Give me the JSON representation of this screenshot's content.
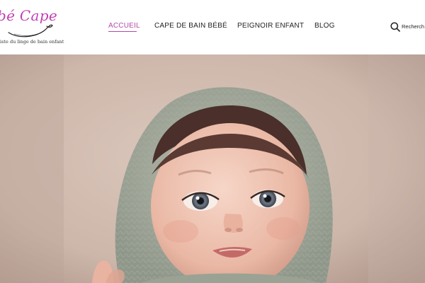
{
  "logo": {
    "script_text": "bé Cape",
    "tagline": "iste du linge de bain enfant"
  },
  "nav": {
    "items": [
      {
        "label": "ACCUEIL",
        "active": true
      },
      {
        "label": "CAPE DE BAIN BÉBÉ",
        "active": false
      },
      {
        "label": "PEIGNOIR ENFANT",
        "active": false
      },
      {
        "label": "BLOG",
        "active": false
      }
    ]
  },
  "search": {
    "label": "Recherch",
    "icon": "search-icon"
  },
  "hero": {
    "image": "baby-in-knitted-hood-photo"
  },
  "colors": {
    "accent": "#b24aa6",
    "logo": "#c23fb3",
    "text": "#222222",
    "background": "#ffffff"
  }
}
